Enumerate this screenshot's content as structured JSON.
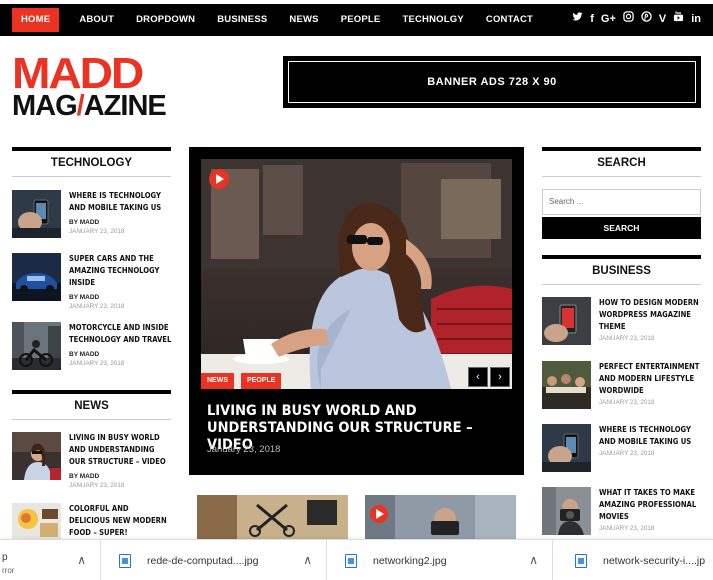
{
  "nav": {
    "items": [
      "HOME",
      "ABOUT",
      "DROPDOWN",
      "BUSINESS",
      "NEWS",
      "PEOPLE",
      "TECHNOLGY",
      "CONTACT"
    ],
    "social": [
      "twitter-icon",
      "facebook-icon",
      "google-plus-icon",
      "instagram-icon",
      "pinterest-icon",
      "vimeo-icon",
      "youtube-icon",
      "linkedin-icon"
    ],
    "social_glyphs": [
      "𝕥",
      "f",
      "G+",
      "◎",
      "℗",
      "V",
      "▣",
      "in"
    ]
  },
  "logo": {
    "line1": "MADD",
    "line2a": "MAG",
    "slash": "/",
    "line2b": "AZINE"
  },
  "banner": {
    "text": "BANNER ADS 728 X 90"
  },
  "technology": {
    "heading": "TECHNOLOGY",
    "posts": [
      {
        "title": "WHERE IS TECHNOLOGY AND MOBILE TAKING US",
        "by": "BY MADD",
        "date": "JANUARY 23, 2018"
      },
      {
        "title": "SUPER CARS AND THE AMAZING TECHNOLOGY INSIDE",
        "by": "BY MADD",
        "date": "JANUARY 23, 2018"
      },
      {
        "title": "MOTORCYCLE AND INSIDE TECHNOLOGY AND TRAVEL",
        "by": "BY MADD",
        "date": "JANUARY 23, 2018"
      }
    ]
  },
  "news": {
    "heading": "NEWS",
    "posts": [
      {
        "title": "LIVING IN BUSY WORLD AND UNDERSTANDING OUR STRUCTURE – VIDEO",
        "by": "BY MADD",
        "date": "JANUARY 23, 2018"
      },
      {
        "title": "COLORFUL AND DELICIOUS NEW MODERN FOOD – SUPER!",
        "by": "",
        "date": ""
      }
    ]
  },
  "featured": {
    "tags": [
      "NEWS",
      "PEOPLE"
    ],
    "title": "LIVING IN BUSY WORLD AND UNDERSTANDING OUR STRUCTURE – VIDEO",
    "date": "January 23, 2018",
    "prev": "‹",
    "next": "›"
  },
  "search": {
    "heading": "SEARCH",
    "placeholder": "Search ...",
    "button": "SEARCH"
  },
  "business": {
    "heading": "BUSINESS",
    "posts": [
      {
        "title": "HOW TO DESIGN MODERN WORDPRESS MAGAZINE THEME",
        "date": "JANUARY 23, 2018"
      },
      {
        "title": "PERFECT ENTERTAINMENT AND MODERN LIFESTYLE WORDWIDE",
        "date": "JANUARY 23, 2018"
      },
      {
        "title": "WHERE IS TECHNOLOGY AND MOBILE TAKING US",
        "date": "JANUARY 23, 2018"
      },
      {
        "title": "WHAT IT TAKES TO MAKE AMAZING PROFESSIONAL MOVIES",
        "date": "JANUARY 23, 2018"
      }
    ]
  },
  "downloads": {
    "items": [
      {
        "name": "p",
        "sub": "rror"
      },
      {
        "name": "rede-de-computad....jpg"
      },
      {
        "name": "networking2.jpg"
      },
      {
        "name": "network-security-i....jp"
      }
    ],
    "chevron": "∧"
  },
  "colors": {
    "accent": "#ea3323",
    "nav_bg": "#000000"
  }
}
